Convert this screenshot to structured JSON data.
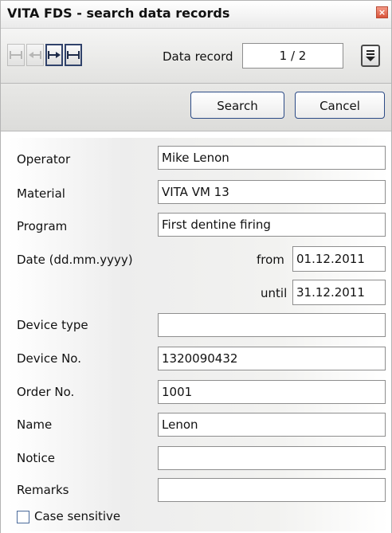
{
  "window": {
    "title": "VITA FDS - search data records",
    "close": "×"
  },
  "toolbar": {
    "nav": [
      {
        "icon": "first-record-icon",
        "enabled": false
      },
      {
        "icon": "previous-record-icon",
        "enabled": false
      },
      {
        "icon": "next-record-icon",
        "enabled": true
      },
      {
        "icon": "last-record-icon",
        "enabled": true
      }
    ],
    "record_label": "Data record",
    "record_value": "1 / 2",
    "dropdown_icon": "dropdown-arrow-icon"
  },
  "actions": {
    "search": "Search",
    "cancel": "Cancel"
  },
  "form": {
    "operator": {
      "label": "Operator",
      "value": "Mike Lenon"
    },
    "material": {
      "label": "Material",
      "value": "VITA VM 13"
    },
    "program": {
      "label": "Program",
      "value": "First dentine firing"
    },
    "date": {
      "label": "Date (dd.mm.yyyy)",
      "from_label": "from",
      "from_value": "01.12.2011",
      "until_label": "until",
      "until_value": "31.12.2011"
    },
    "device_type": {
      "label": "Device type",
      "value": ""
    },
    "device_no": {
      "label": "Device No.",
      "value": "1320090432"
    },
    "order_no": {
      "label": "Order No.",
      "value": "1001"
    },
    "name": {
      "label": "Name",
      "value": "Lenon"
    },
    "notice": {
      "label": "Notice",
      "value": ""
    },
    "remarks": {
      "label": "Remarks",
      "value": ""
    },
    "case_sensitive": {
      "label": "Case sensitive",
      "checked": false
    }
  },
  "colors": {
    "accent_border": "#2c4b86",
    "close_red": "#d9533a",
    "nav_active": "#30426b"
  }
}
